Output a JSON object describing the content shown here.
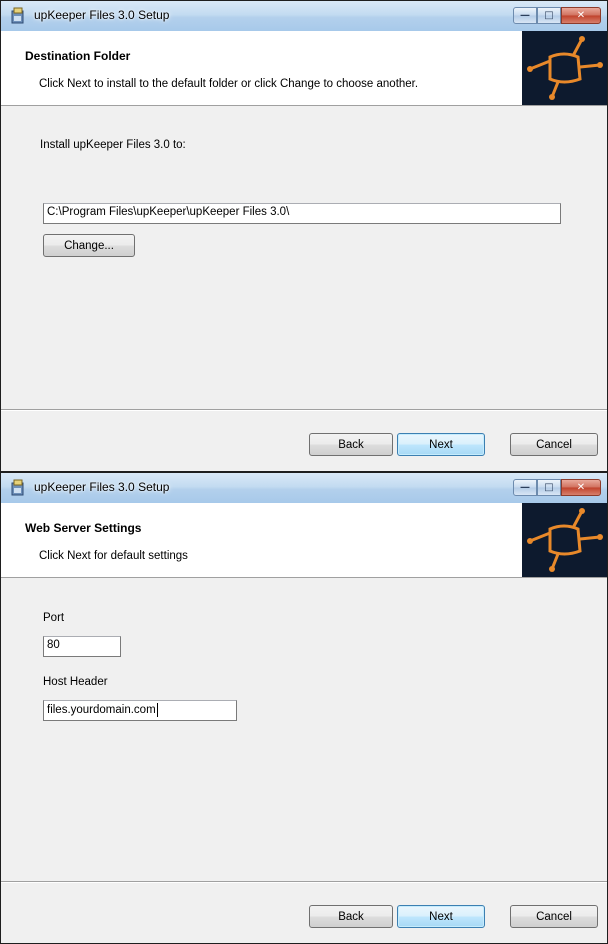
{
  "windows": [
    {
      "title": "upKeeper Files 3.0 Setup",
      "banner_title": "Destination Folder",
      "banner_desc": "Click Next to install to the default folder or click Change to choose another.",
      "install_label": "Install upKeeper Files 3.0 to:",
      "path_value": "C:\\Program Files\\upKeeper\\upKeeper Files 3.0\\",
      "change_label": "Change...",
      "back_label": "Back",
      "next_label": "Next",
      "cancel_label": "Cancel"
    },
    {
      "title": "upKeeper Files 3.0 Setup",
      "banner_title": "Web Server Settings",
      "banner_desc": "Click Next for default settings",
      "port_label": "Port",
      "port_value": "80",
      "host_label": "Host Header",
      "host_value": "files.yourdomain.com",
      "back_label": "Back",
      "next_label": "Next",
      "cancel_label": "Cancel"
    }
  ],
  "icons": [
    "installer-icon",
    "minimize-icon",
    "maximize-icon",
    "close-icon",
    "upkeeper-logo"
  ],
  "colors": {
    "titlebar": "#b9d4ee",
    "logo_bg": "#0d1a2e",
    "logo_accent": "#e8892a",
    "close_red": "#c0412a"
  }
}
